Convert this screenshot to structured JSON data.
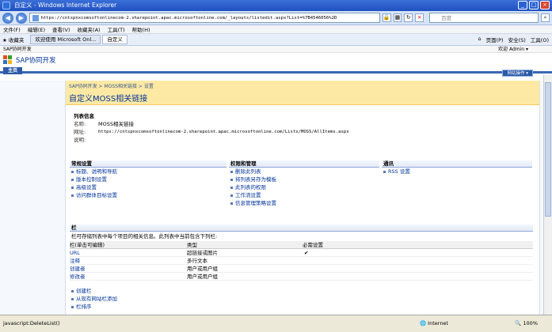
{
  "window": {
    "title": "自定义 - Windows Internet Explorer"
  },
  "addressbar": {
    "url": "https://cntspnxcomsoftonlinecom-2.sharepoint.apac.microsoftonline.com/_layouts/listedit.aspx?List=%7B4546056%2D",
    "search_placeholder": "百度"
  },
  "menubar": {
    "items": [
      "文件(F)",
      "编辑(E)",
      "查看(V)",
      "收藏夹(A)",
      "工具(T)",
      "帮助(H)"
    ]
  },
  "tabs": {
    "favorites": "收藏夹",
    "tab1": "欢迎使用 Microsoft Onl...",
    "tab2": "自定义",
    "commands": [
      "页面(P)",
      "安全(S)",
      "工具(O)"
    ]
  },
  "sharepoint": {
    "top_label": "SAP协同开发",
    "welcome": "欢迎 Admin",
    "my_site": "",
    "site_title": "SAP协同开发",
    "home_tab": "主页",
    "site_actions": "网站操作",
    "breadcrumb": "SAP协同开发 > MOSS相关链接 > 设置",
    "page_title": "自定义MOSS相关链接"
  },
  "listinfo": {
    "heading": "列表信息",
    "name_label": "名称:",
    "name_value": "MOSS相关链接",
    "url_label": "网址:",
    "url_value": "https://cntspnxcomsoftonlinecom-2.sharepoint.apac.microsoftonline.com/Lists/MOSS/AllItems.aspx",
    "desc_label": "说明:"
  },
  "general": {
    "heading": "常规设置",
    "links": [
      "标题、说明和导航",
      "版本控制设置",
      "高级设置",
      "访问群体目标设置"
    ]
  },
  "permissions": {
    "heading": "权限和管理",
    "links": [
      "删除此列表",
      "将列表另存为模板",
      "此列表的权限",
      "工作流设置",
      "信息管理策略设置"
    ]
  },
  "communications": {
    "heading": "通讯",
    "links": [
      "RSS 设置"
    ]
  },
  "columns": {
    "heading": "栏",
    "description": "栏可存储列表中每个项目的相关信息。此列表中当前包含下列栏:",
    "header": [
      "栏(单击可编辑)",
      "类型",
      "必需设置"
    ],
    "rows": [
      [
        "URL",
        "超链接或图片",
        "✔"
      ],
      [
        "注释",
        "多行文本",
        ""
      ],
      [
        "创建者",
        "用户或用户组",
        ""
      ],
      [
        "修改者",
        "用户或用户组",
        ""
      ]
    ],
    "links": [
      "创建栏",
      "从现有网站栏添加",
      "栏排序"
    ]
  },
  "statusbar": {
    "left": "javascript:DeleteList()",
    "zone": "Internet",
    "zoom": "100%"
  }
}
